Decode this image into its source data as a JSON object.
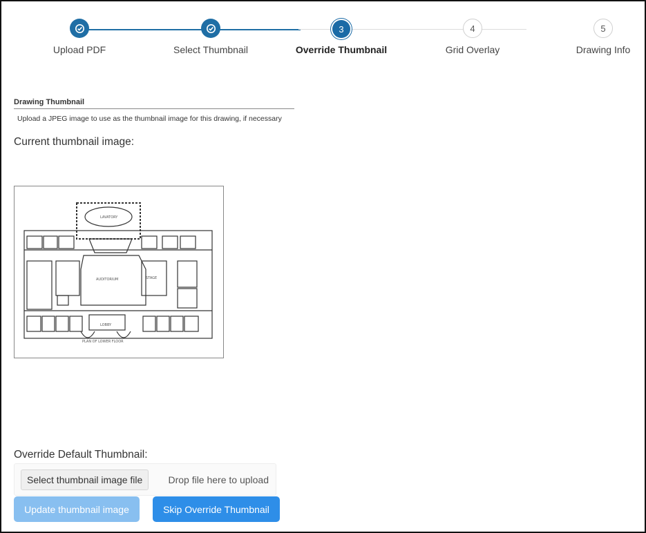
{
  "stepper": {
    "steps": [
      {
        "label": "Upload PDF",
        "number": "1",
        "state": "done",
        "icon": "check-icon"
      },
      {
        "label": "Select Thumbnail",
        "number": "2",
        "state": "done",
        "icon": "check-icon"
      },
      {
        "label": "Override Thumbnail",
        "number": "3",
        "state": "active"
      },
      {
        "label": "Grid Overlay",
        "number": "4",
        "state": "todo"
      },
      {
        "label": "Drawing Info",
        "number": "5",
        "state": "todo"
      }
    ],
    "colors": {
      "done": "#1f6ea5",
      "todo_line": "#dcdcdc"
    }
  },
  "section": {
    "title": "Drawing Thumbnail",
    "description": "Upload a JPEG image to use as the thumbnail image for this drawing, if necessary"
  },
  "current_thumbnail": {
    "label": "Current thumbnail image:",
    "image_caption": "PLAN OF LOWER FLOOR",
    "room_labels": [
      "LAVATORY",
      "AUDITORIUM",
      "LOBBY",
      "STAGE"
    ]
  },
  "override": {
    "label": "Override Default Thumbnail:",
    "select_button_label": "Select thumbnail image file",
    "drop_text": "Drop file here to upload"
  },
  "actions": {
    "update_label": "Update thumbnail image",
    "skip_label": "Skip Override Thumbnail",
    "update_color": "#88bff0",
    "skip_color": "#2e8ee8"
  }
}
